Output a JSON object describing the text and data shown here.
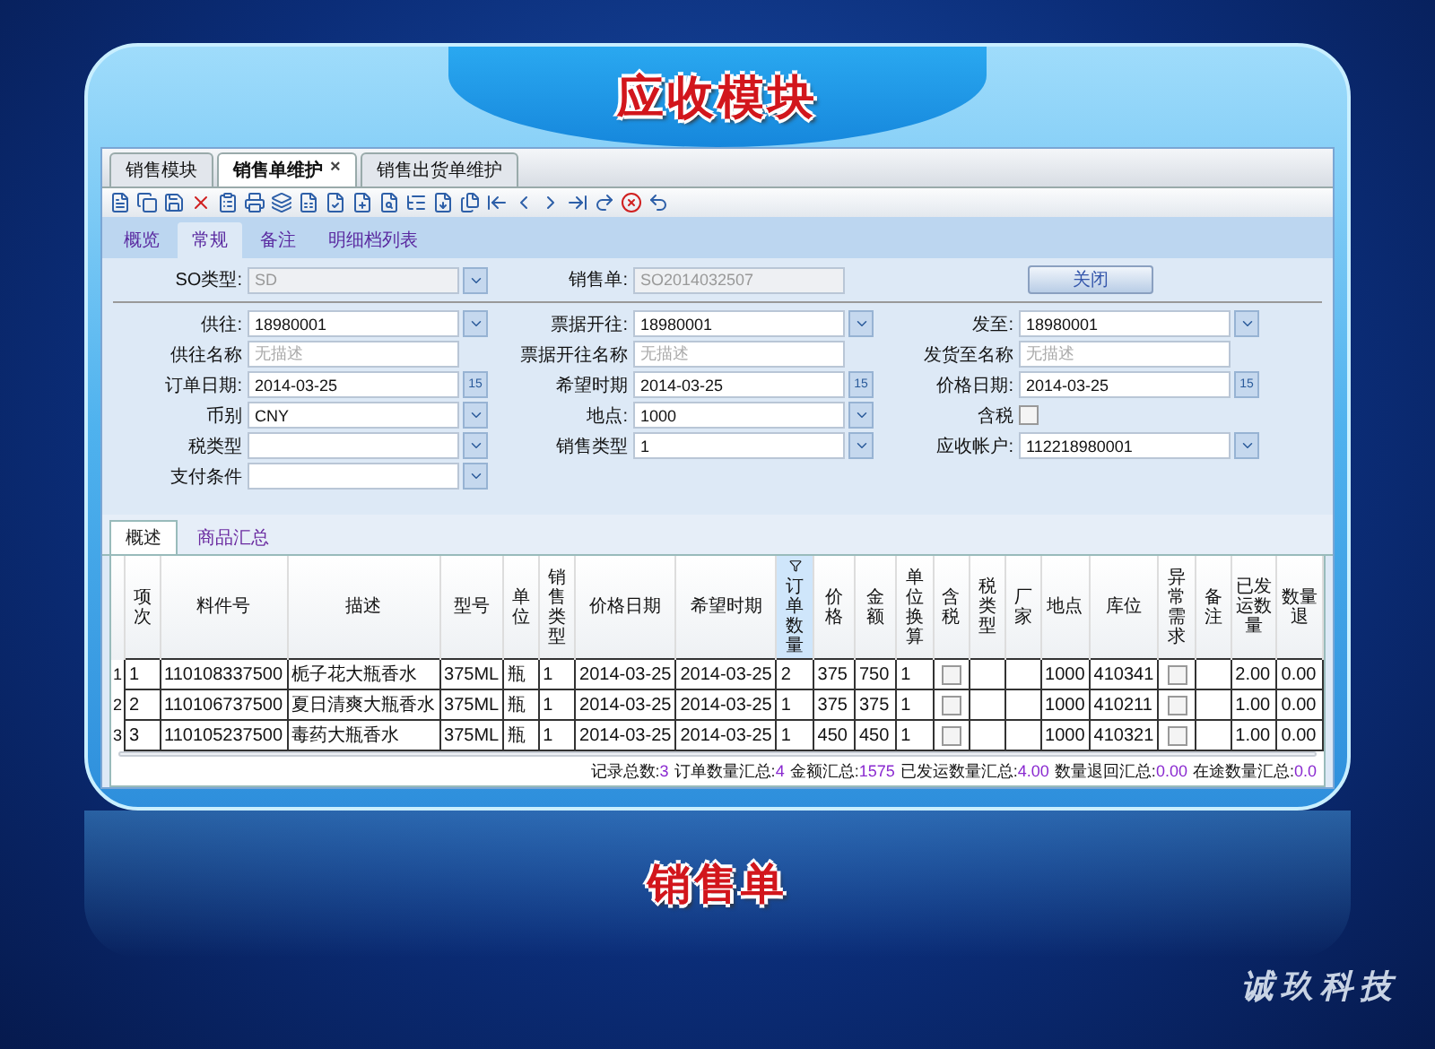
{
  "banner": {
    "title": "应收模块"
  },
  "window_tabs": [
    {
      "label": "销售模块",
      "selected": false,
      "closable": false
    },
    {
      "label": "销售单维护",
      "selected": true,
      "closable": true,
      "close": "×"
    },
    {
      "label": "销售出货单维护",
      "selected": false,
      "closable": false
    }
  ],
  "form_tabs": [
    {
      "label": "概览",
      "selected": false
    },
    {
      "label": "常规",
      "selected": true
    },
    {
      "label": "备注",
      "selected": false
    },
    {
      "label": "明细档列表",
      "selected": false
    }
  ],
  "header_fields": [
    {
      "label": "SO类型:",
      "kind": "select",
      "value": "SD",
      "disabled": true
    },
    {
      "label": "销售单:",
      "kind": "text",
      "value": "SO2014032507",
      "disabled": true
    }
  ],
  "close_button": "关闭",
  "rows": [
    [
      {
        "label": "供往:",
        "kind": "select",
        "value": "18980001"
      },
      {
        "label": "票据开往:",
        "kind": "select",
        "value": "18980001"
      },
      {
        "label": "发至:",
        "kind": "select",
        "value": "18980001"
      }
    ],
    [
      {
        "label": "供往名称",
        "kind": "text",
        "placeholder": "无描述"
      },
      {
        "label": "票据开往名称",
        "kind": "text",
        "placeholder": "无描述"
      },
      {
        "label": "发货至名称",
        "kind": "text",
        "placeholder": "无描述"
      }
    ],
    [
      {
        "label": "订单日期:",
        "kind": "date",
        "value": "2014-03-25",
        "icon_text": "15"
      },
      {
        "label": "希望时期",
        "kind": "date",
        "value": "2014-03-25",
        "icon_text": "15"
      },
      {
        "label": "价格日期:",
        "kind": "date",
        "value": "2014-03-25",
        "icon_text": "15"
      }
    ],
    [
      {
        "label": "币别",
        "kind": "select",
        "value": "CNY"
      },
      {
        "label": "地点:",
        "kind": "select",
        "value": "1000"
      },
      {
        "label": "含税",
        "kind": "checkbox",
        "checked": false
      }
    ],
    [
      {
        "label": "税类型",
        "kind": "select"
      },
      {
        "label": "销售类型",
        "kind": "select",
        "value": "1"
      },
      {
        "label": "应收帐户:",
        "kind": "select",
        "value": "112218980001"
      }
    ],
    [
      {
        "label": "支付条件",
        "kind": "select"
      }
    ]
  ],
  "detail_tabs": [
    {
      "label": "概述",
      "selected": true
    },
    {
      "label": "商品汇总",
      "selected": false
    }
  ],
  "table": {
    "columns": [
      {
        "label": "项次",
        "kind": "text",
        "selected": false
      },
      {
        "label": "料件号",
        "kind": "text",
        "selected": false
      },
      {
        "label": "描述",
        "kind": "text",
        "selected": false
      },
      {
        "label": "型号",
        "kind": "text",
        "selected": false
      },
      {
        "label": "单位",
        "kind": "text",
        "selected": false
      },
      {
        "label": "销售类型",
        "kind": "text",
        "selected": false
      },
      {
        "label": "价格日期",
        "kind": "text",
        "selected": false
      },
      {
        "label": "希望时期",
        "kind": "text",
        "selected": false
      },
      {
        "label": "订单数量",
        "kind": "text",
        "selected": true
      },
      {
        "label": "价格",
        "kind": "text",
        "selected": false
      },
      {
        "label": "金额",
        "kind": "text",
        "selected": false
      },
      {
        "label": "单位换算",
        "kind": "text",
        "selected": false
      },
      {
        "label": "含税",
        "kind": "checkbox",
        "selected": false
      },
      {
        "label": "税类型",
        "kind": "text",
        "selected": false
      },
      {
        "label": "厂家",
        "kind": "text",
        "selected": false
      },
      {
        "label": "地点",
        "kind": "text",
        "selected": false
      },
      {
        "label": "库位",
        "kind": "text",
        "selected": false
      },
      {
        "label": "异常需求",
        "kind": "checkbox",
        "selected": false
      },
      {
        "label": "备注",
        "kind": "text",
        "selected": false
      },
      {
        "label": "已发运数量",
        "kind": "text",
        "selected": false
      },
      {
        "label": "数量退",
        "kind": "text",
        "selected": false
      }
    ],
    "rows": [
      {
        "number": "1",
        "cells": [
          "1",
          "110108337500",
          "栀子花大瓶香水",
          "375ML",
          "瓶",
          "1",
          "2014-03-25",
          "2014-03-25",
          "2",
          "375",
          "750",
          "1",
          {
            "checked": false
          },
          null,
          null,
          "1000",
          "410341",
          {
            "checked": false
          },
          null,
          "2.00",
          "0.00"
        ]
      },
      {
        "number": "2",
        "cells": [
          "2",
          "110106737500",
          "夏日清爽大瓶香水",
          "375ML",
          "瓶",
          "1",
          "2014-03-25",
          "2014-03-25",
          "1",
          "375",
          "375",
          "1",
          {
            "checked": false
          },
          null,
          null,
          "1000",
          "410211",
          {
            "checked": false
          },
          null,
          "1.00",
          "0.00"
        ]
      },
      {
        "number": "3",
        "cells": [
          "3",
          "110105237500",
          "毒药大瓶香水",
          "375ML",
          "瓶",
          "1",
          "2014-03-25",
          "2014-03-25",
          "1",
          "450",
          "450",
          "1",
          {
            "checked": false
          },
          null,
          null,
          "1000",
          "410321",
          {
            "checked": false
          },
          null,
          "1.00",
          "0.00"
        ]
      }
    ]
  },
  "summary": [
    {
      "label": "记录总数:",
      "value": "3"
    },
    {
      "label": "订单数量汇总:",
      "value": "4"
    },
    {
      "label": "金额汇总:",
      "value": "1575"
    },
    {
      "label": "已发运数量汇总:",
      "value": "4.00"
    },
    {
      "label": "数量退回汇总:",
      "value": "0.00"
    },
    {
      "label": "在途数量汇总:",
      "value": "0.0"
    }
  ],
  "caption": "销售单",
  "brand": "诚玖科技"
}
